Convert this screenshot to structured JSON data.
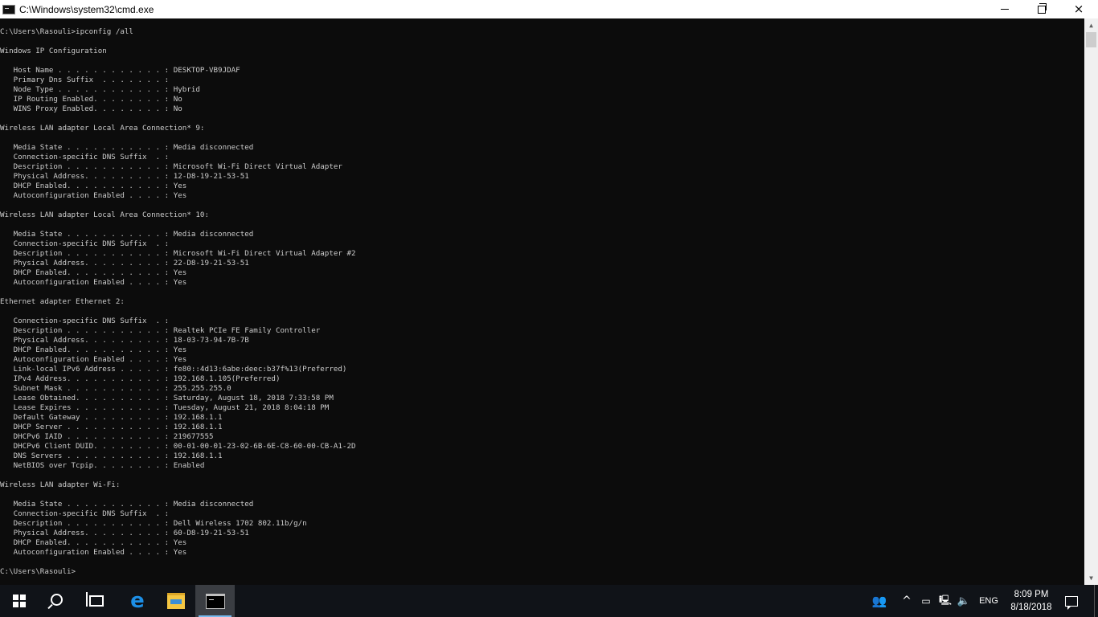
{
  "window": {
    "title": "C:\\Windows\\system32\\cmd.exe",
    "icon": "cmd-icon",
    "controls": {
      "minimize": "minimize-icon",
      "maximize": "restore-icon",
      "close": "×"
    }
  },
  "console": {
    "text_color": "#cccccc",
    "background": "#0c0c0c",
    "lines": [
      "C:\\Users\\Rasouli>ipconfig /all",
      "",
      "Windows IP Configuration",
      "",
      "   Host Name . . . . . . . . . . . . : DESKTOP-VB9JDAF",
      "   Primary Dns Suffix  . . . . . . . :",
      "   Node Type . . . . . . . . . . . . : Hybrid",
      "   IP Routing Enabled. . . . . . . . : No",
      "   WINS Proxy Enabled. . . . . . . . : No",
      "",
      "Wireless LAN adapter Local Area Connection* 9:",
      "",
      "   Media State . . . . . . . . . . . : Media disconnected",
      "   Connection-specific DNS Suffix  . :",
      "   Description . . . . . . . . . . . : Microsoft Wi-Fi Direct Virtual Adapter",
      "   Physical Address. . . . . . . . . : 12-D8-19-21-53-51",
      "   DHCP Enabled. . . . . . . . . . . : Yes",
      "   Autoconfiguration Enabled . . . . : Yes",
      "",
      "Wireless LAN adapter Local Area Connection* 10:",
      "",
      "   Media State . . . . . . . . . . . : Media disconnected",
      "   Connection-specific DNS Suffix  . :",
      "   Description . . . . . . . . . . . : Microsoft Wi-Fi Direct Virtual Adapter #2",
      "   Physical Address. . . . . . . . . : 22-D8-19-21-53-51",
      "   DHCP Enabled. . . . . . . . . . . : Yes",
      "   Autoconfiguration Enabled . . . . : Yes",
      "",
      "Ethernet adapter Ethernet 2:",
      "",
      "   Connection-specific DNS Suffix  . :",
      "   Description . . . . . . . . . . . : Realtek PCIe FE Family Controller",
      "   Physical Address. . . . . . . . . : 18-03-73-94-7B-7B",
      "   DHCP Enabled. . . . . . . . . . . : Yes",
      "   Autoconfiguration Enabled . . . . : Yes",
      "   Link-local IPv6 Address . . . . . : fe80::4d13:6abe:deec:b37f%13(Preferred)",
      "   IPv4 Address. . . . . . . . . . . : 192.168.1.105(Preferred)",
      "   Subnet Mask . . . . . . . . . . . : 255.255.255.0",
      "   Lease Obtained. . . . . . . . . . : Saturday, August 18, 2018 7:33:58 PM",
      "   Lease Expires . . . . . . . . . . : Tuesday, August 21, 2018 8:04:18 PM",
      "   Default Gateway . . . . . . . . . : 192.168.1.1",
      "   DHCP Server . . . . . . . . . . . : 192.168.1.1",
      "   DHCPv6 IAID . . . . . . . . . . . : 219677555",
      "   DHCPv6 Client DUID. . . . . . . . : 00-01-00-01-23-02-6B-6E-C8-60-00-CB-A1-2D",
      "   DNS Servers . . . . . . . . . . . : 192.168.1.1",
      "   NetBIOS over Tcpip. . . . . . . . : Enabled",
      "",
      "Wireless LAN adapter Wi-Fi:",
      "",
      "   Media State . . . . . . . . . . . : Media disconnected",
      "   Connection-specific DNS Suffix  . :",
      "   Description . . . . . . . . . . . : Dell Wireless 1702 802.11b/g/n",
      "   Physical Address. . . . . . . . . : 60-D8-19-21-53-51",
      "   DHCP Enabled. . . . . . . . . . . : Yes",
      "   Autoconfiguration Enabled . . . . : Yes",
      "",
      "C:\\Users\\Rasouli>"
    ]
  },
  "scrollbar": {
    "up_arrow": "▲",
    "down_arrow": "▼"
  },
  "taskbar": {
    "background": "#101318",
    "pinned": [
      {
        "name": "start-button",
        "icon": "windows-logo-icon"
      },
      {
        "name": "search-button",
        "icon": "search-icon"
      },
      {
        "name": "task-view-button",
        "icon": "task-view-icon"
      },
      {
        "name": "edge-button",
        "icon": "edge-icon",
        "glyph": "e"
      },
      {
        "name": "file-explorer-button",
        "icon": "folder-icon"
      },
      {
        "name": "cmd-taskbar-button",
        "icon": "cmd-icon",
        "active": true
      }
    ],
    "tray": {
      "people_glyph": "👥",
      "chevron_glyph": "^",
      "battery_glyph": "▭",
      "network_glyph": "🖳",
      "volume_glyph": "🔈",
      "language": "ENG",
      "time": "8:09 PM",
      "date": "8/18/2018"
    }
  }
}
